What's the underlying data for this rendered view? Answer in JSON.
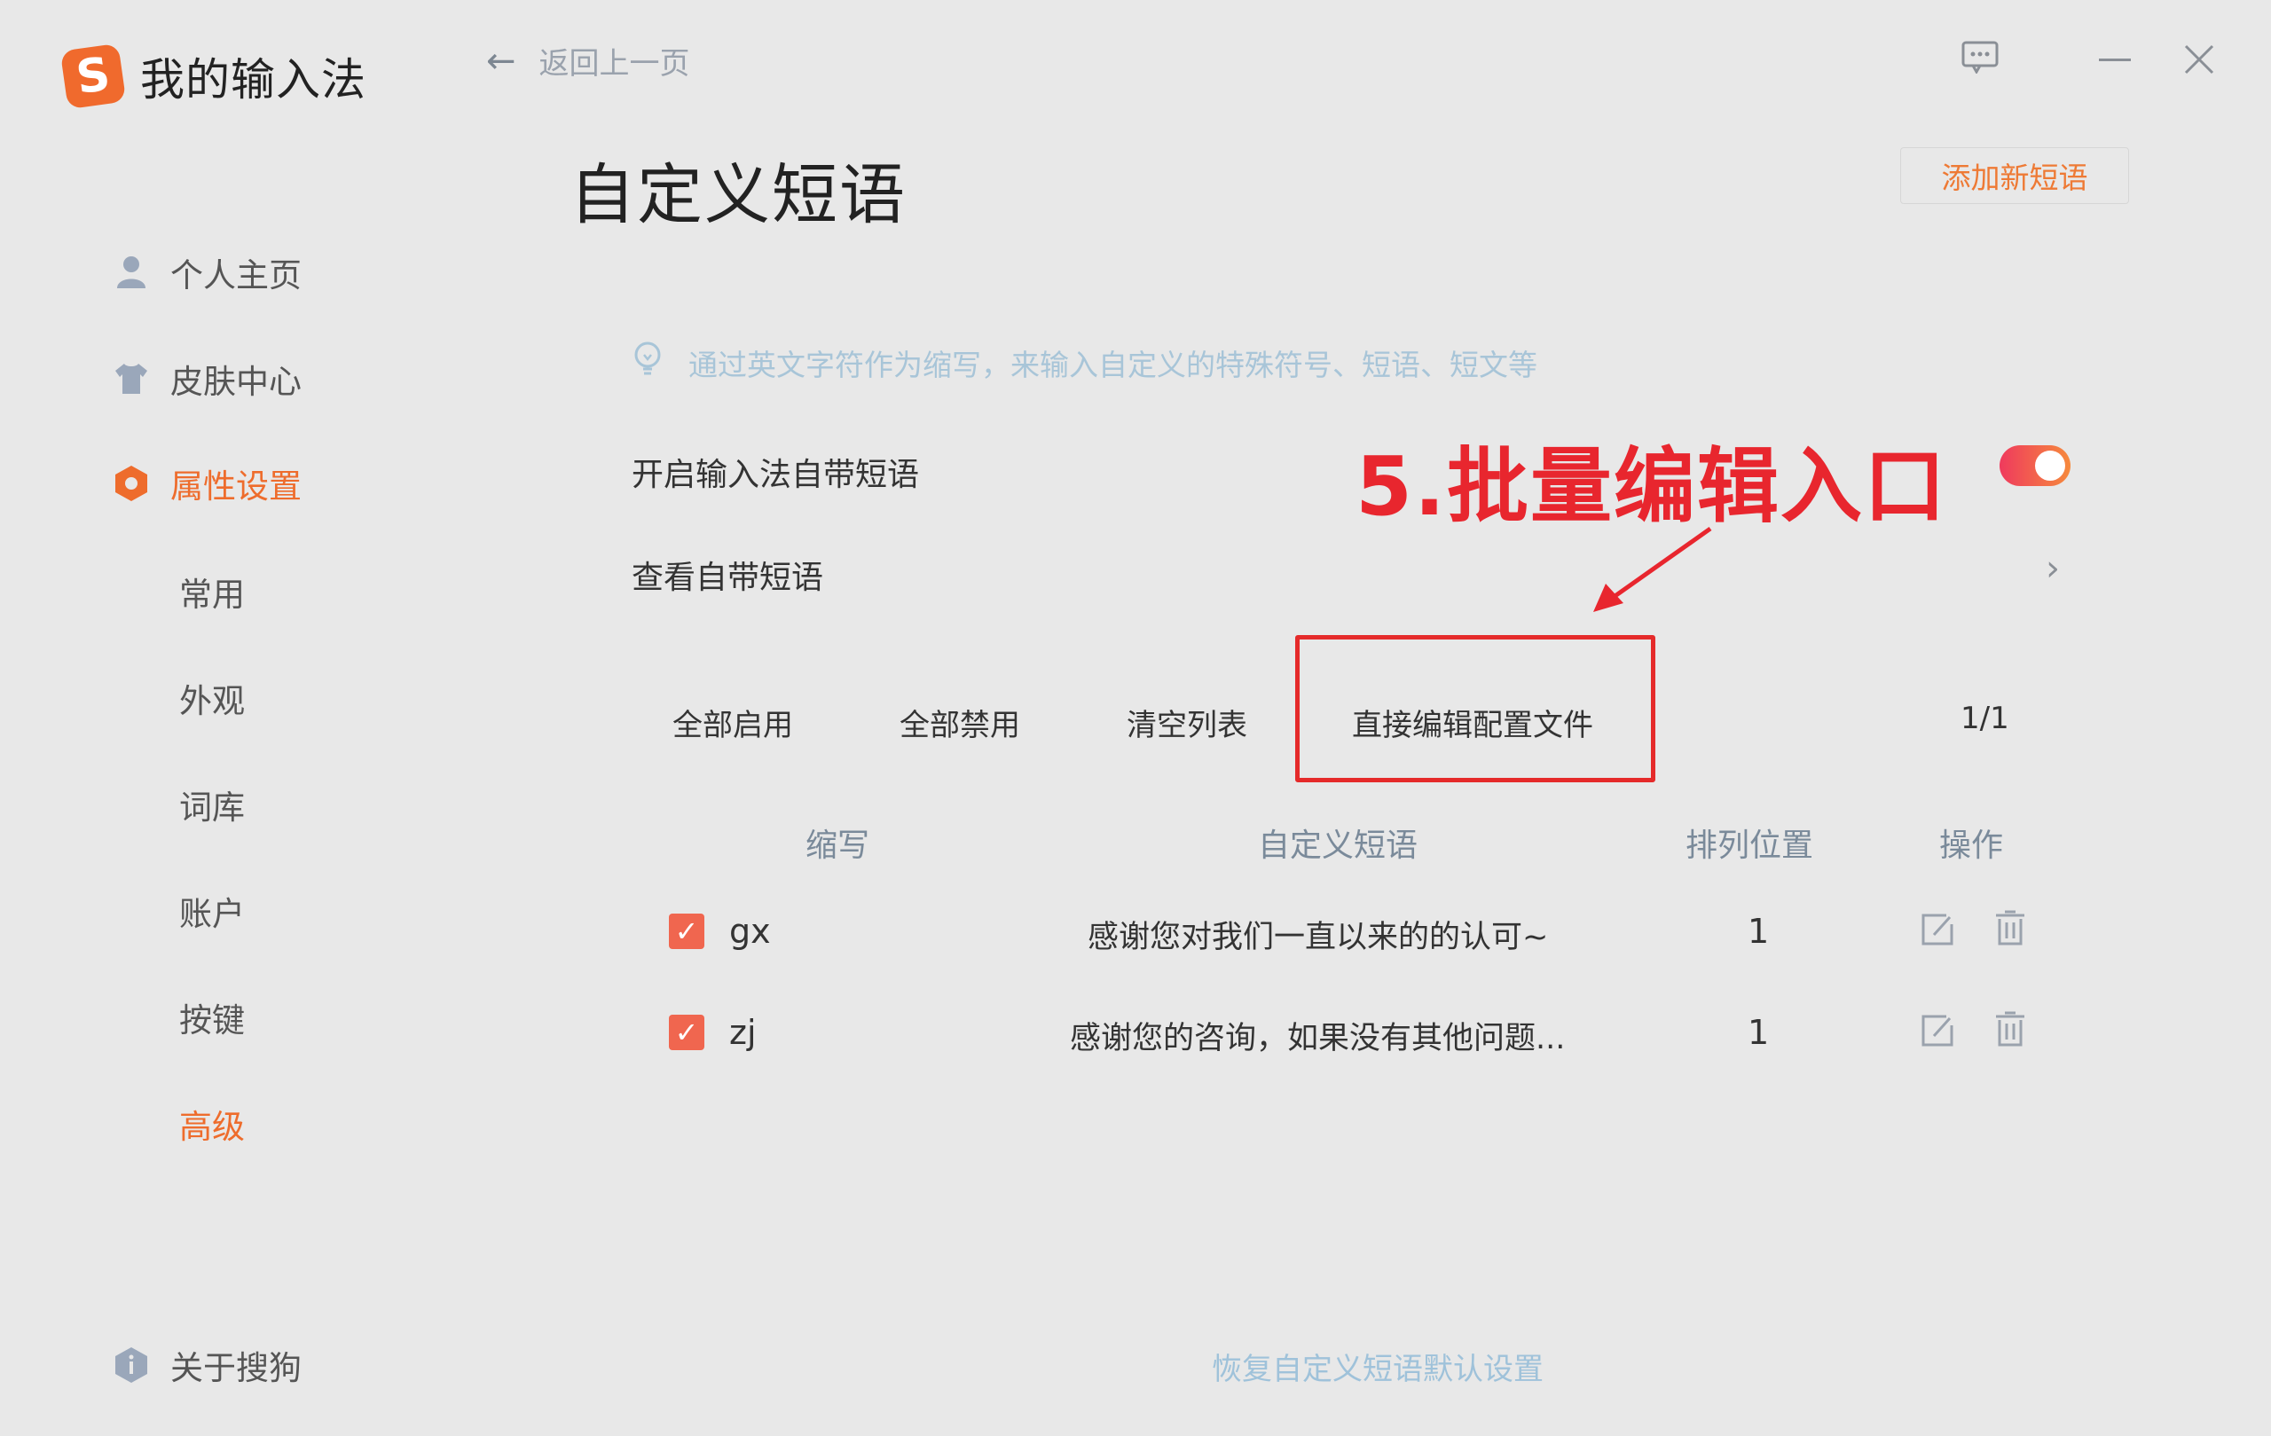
{
  "app": {
    "logo_letter": "S",
    "title": "我的输入法"
  },
  "header": {
    "back_label": "返回上一页"
  },
  "sidebar": {
    "items": [
      {
        "label": "个人主页",
        "icon": "user-icon"
      },
      {
        "label": "皮肤中心",
        "icon": "shirt-icon"
      },
      {
        "label": "属性设置",
        "icon": "settings-hex-icon",
        "active": true
      }
    ],
    "sub_items": [
      {
        "label": "常用"
      },
      {
        "label": "外观"
      },
      {
        "label": "词库"
      },
      {
        "label": "账户"
      },
      {
        "label": "按键"
      },
      {
        "label": "高级",
        "active": true
      }
    ],
    "about_label": "关于搜狗"
  },
  "page": {
    "title": "自定义短语",
    "add_button": "添加新短语",
    "hint": "通过英文字符作为缩写，来输入自定义的特殊符号、短语、短文等",
    "toggle_label": "开启输入法自带短语",
    "toggle_on": true,
    "view_builtin_label": "查看自带短语"
  },
  "annotation": {
    "text": "5.批量编辑入口",
    "color": "#e8262e"
  },
  "toolbar": {
    "enable_all": "全部启用",
    "disable_all": "全部禁用",
    "clear_list": "清空列表",
    "edit_config": "直接编辑配置文件",
    "page_indicator": "1/1"
  },
  "table": {
    "headers": {
      "abbr": "缩写",
      "phrase": "自定义短语",
      "position": "排列位置",
      "actions": "操作"
    },
    "rows": [
      {
        "checked": true,
        "abbr": "gx",
        "phrase": "感谢您对我们一直以来的的认可~",
        "position": "1"
      },
      {
        "checked": true,
        "abbr": "zj",
        "phrase": "感谢您的咨询，如果没有其他问题...",
        "position": "1"
      }
    ]
  },
  "footer": {
    "restore_label": "恢复自定义短语默认设置"
  },
  "colors": {
    "accent": "#ee6c2c",
    "annotation_red": "#e8262e",
    "background": "#e8e8e8"
  }
}
